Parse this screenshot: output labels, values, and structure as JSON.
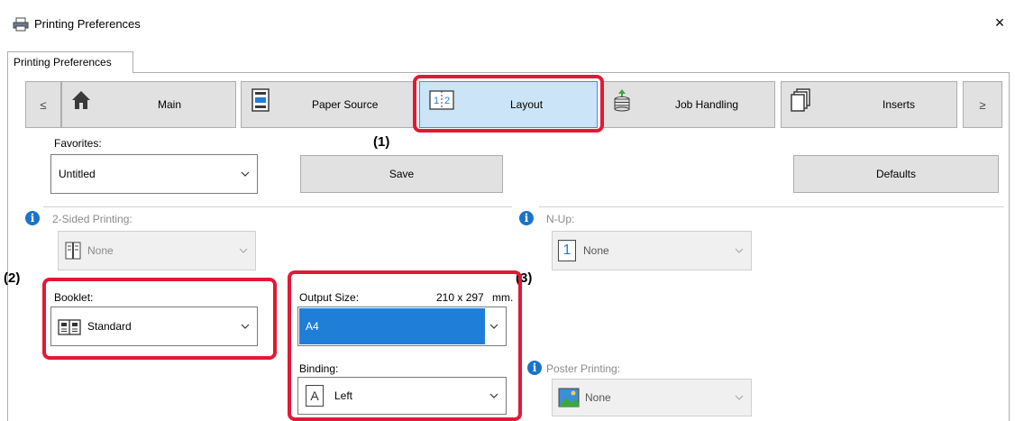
{
  "window": {
    "title": "Printing Preferences",
    "close": "×"
  },
  "outer_tab": {
    "label": "Printing Preferences"
  },
  "ribbon": {
    "prev": "≤",
    "next": "≥",
    "tabs": [
      {
        "label": "Main",
        "icon": "home-icon"
      },
      {
        "label": "Paper Source",
        "icon": "paper-source-icon"
      },
      {
        "label": "Layout",
        "icon": "layout-icon",
        "selected": true
      },
      {
        "label": "Job Handling",
        "icon": "job-handling-icon"
      },
      {
        "label": "Inserts",
        "icon": "inserts-icon"
      }
    ]
  },
  "favorites": {
    "label": "Favorites:",
    "value": "Untitled",
    "save": "Save",
    "defaults": "Defaults"
  },
  "two_sided": {
    "label": "2-Sided Printing:",
    "value": "None",
    "enabled": false
  },
  "nup": {
    "label": "N-Up:",
    "value": "None",
    "icon_digit": "1",
    "enabled": false
  },
  "booklet": {
    "label": "Booklet:",
    "value": "Standard"
  },
  "output_size": {
    "label": "Output Size:",
    "dimensions": "210 x 297",
    "unit": "mm.",
    "value": "A4"
  },
  "binding": {
    "label": "Binding:",
    "value": "Left",
    "icon_letter": "A"
  },
  "poster": {
    "label": "Poster Printing:",
    "value": "None",
    "enabled": false
  },
  "callouts": [
    "(1)",
    "(2)",
    "(3)"
  ],
  "colors": {
    "highlight_red": "#e31837",
    "selected_blue": "#1f7fd8",
    "info_blue": "#1a73c9"
  }
}
